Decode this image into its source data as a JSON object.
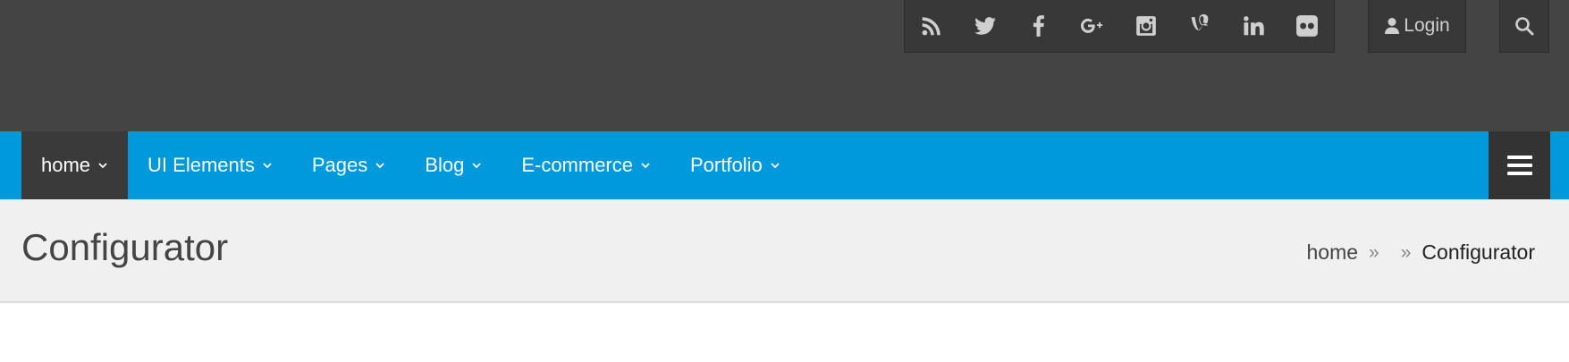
{
  "header": {
    "social_icons": [
      "rss-icon",
      "twitter-icon",
      "facebook-icon",
      "google-plus-icon",
      "instagram-icon",
      "vine-icon",
      "linkedin-icon",
      "flickr-icon"
    ],
    "login_label": "Login",
    "search_icon": "search-icon"
  },
  "nav": {
    "items": [
      {
        "label": "home",
        "active": true
      },
      {
        "label": "UI Elements"
      },
      {
        "label": "Pages"
      },
      {
        "label": "Blog"
      },
      {
        "label": "E-commerce"
      },
      {
        "label": "Portfolio"
      }
    ],
    "menu_icon": "hamburger-menu-icon"
  },
  "page": {
    "title": "Configurator",
    "breadcrumb": {
      "home": "home",
      "separator": "»",
      "current": "Configurator"
    }
  },
  "colors": {
    "topbar": "#444444",
    "nav": "#0099dc",
    "active": "#3a3a3a",
    "titlebar": "#f0f0f0"
  }
}
